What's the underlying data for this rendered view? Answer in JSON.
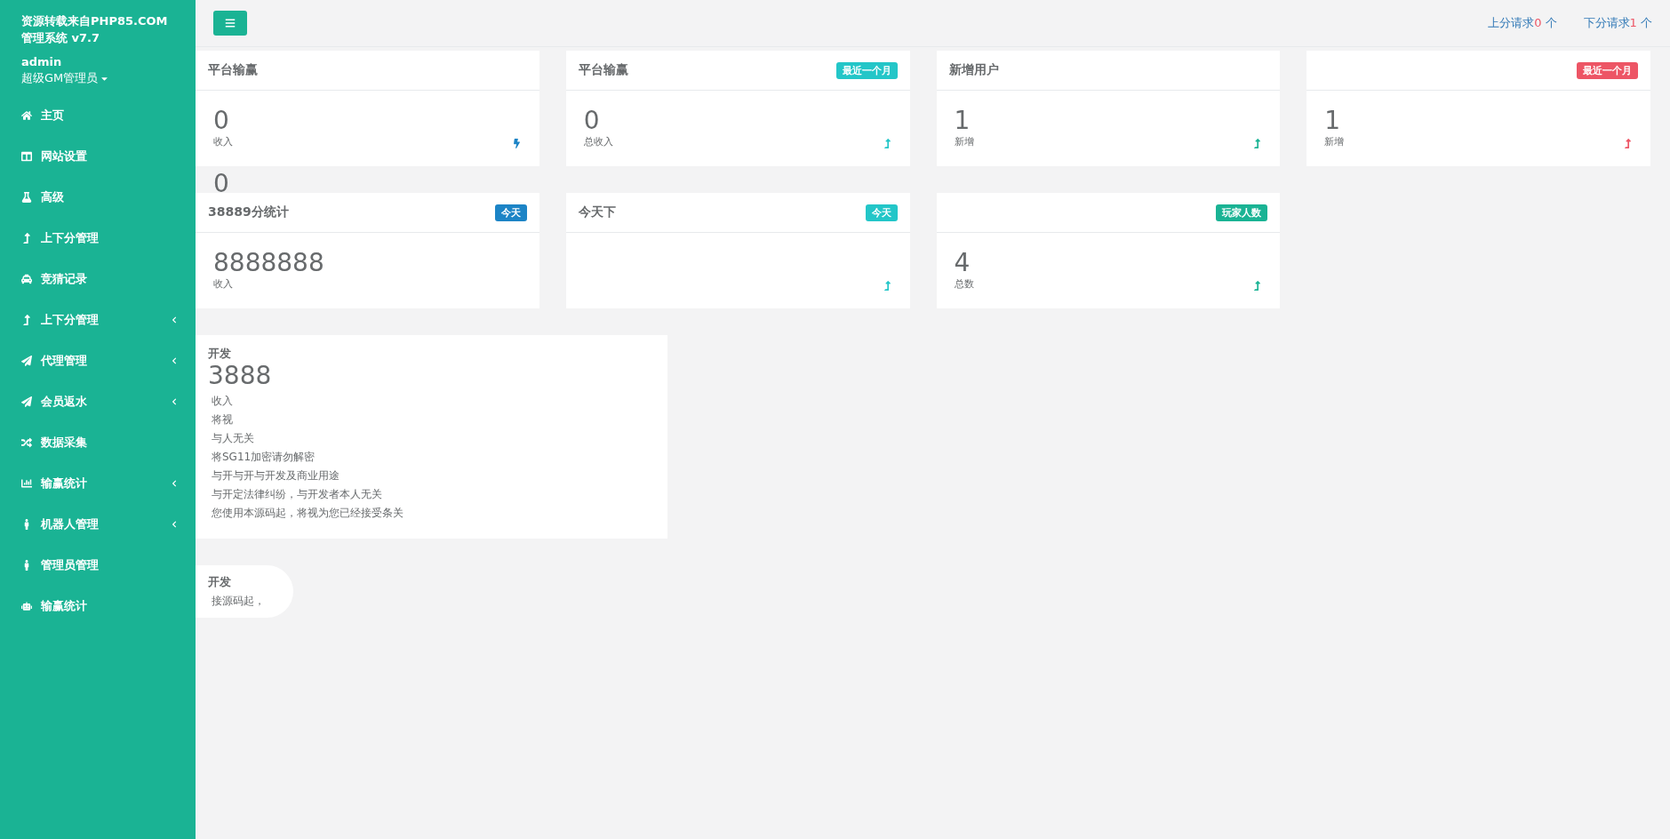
{
  "sidebar": {
    "brand": "资源转载来自PHP85.COM管理系统 v7.7",
    "user": "admin",
    "role": "超级GM管理员",
    "items": [
      {
        "label": "主页",
        "has_submenu": false
      },
      {
        "label": "网站设置",
        "has_submenu": false
      },
      {
        "label": "高级",
        "has_submenu": false
      },
      {
        "label": "上下分管理",
        "has_submenu": false
      },
      {
        "label": "竞猜记录",
        "has_submenu": false
      },
      {
        "label": "上下分管理",
        "has_submenu": true
      },
      {
        "label": "代理管理",
        "has_submenu": true
      },
      {
        "label": "会员返水",
        "has_submenu": true
      },
      {
        "label": "数据采集",
        "has_submenu": false
      },
      {
        "label": "输赢统计",
        "has_submenu": true
      },
      {
        "label": "机器人管理",
        "has_submenu": true
      },
      {
        "label": "管理员管理",
        "has_submenu": false
      },
      {
        "label": "输赢统计",
        "has_submenu": false
      }
    ]
  },
  "topbar": {
    "requests": [
      {
        "label": "上分请求",
        "count": "0",
        "unit": "个"
      },
      {
        "label": "下分请求",
        "count": "1",
        "unit": "个"
      }
    ]
  },
  "card_rows": [
    [
      {
        "title": "平台输赢",
        "value": "0",
        "caption": "收入",
        "color": "#1c84c6",
        "ghost": "0"
      },
      {
        "title": "平台输赢",
        "badge": {
          "text": "最近一个月",
          "color": "#23c6c8"
        },
        "value": "0",
        "caption": "总收入",
        "color": "#23c6c8"
      },
      {
        "title": "新增用户",
        "value": "1",
        "caption": "新增",
        "color": "#1ab394"
      },
      {
        "badge": {
          "text": "最近一个月",
          "color": "#ed5565"
        },
        "value": "1",
        "caption": "新增",
        "color": "#ed5565"
      }
    ],
    [
      {
        "title": "38889分统计",
        "badge": {
          "text": "今天",
          "color": "#1c84c6"
        },
        "value": "8888888",
        "caption": "收入"
      },
      {
        "title": "今天下",
        "badge": {
          "text": "今天",
          "color": "#23c6c8"
        },
        "color": "#23c6c8"
      },
      {
        "badge": {
          "text": "玩家人数",
          "color": "#1ab394"
        },
        "value": "4",
        "caption": "总数",
        "color": "#1ab394"
      }
    ]
  ],
  "notice": {
    "title": "开发",
    "value": "3888",
    "caption": "收入",
    "lines": [
      "将视",
      "与人无关",
      "将SG11加密请勿解密",
      "与开与开与开发及商业用途",
      "与开定法律纠纷，与开发者本人无关",
      "您使用本源码起，将视为您已经接受条关"
    ]
  },
  "notice_2": {
    "title": "开发",
    "text": "接源码起，"
  }
}
